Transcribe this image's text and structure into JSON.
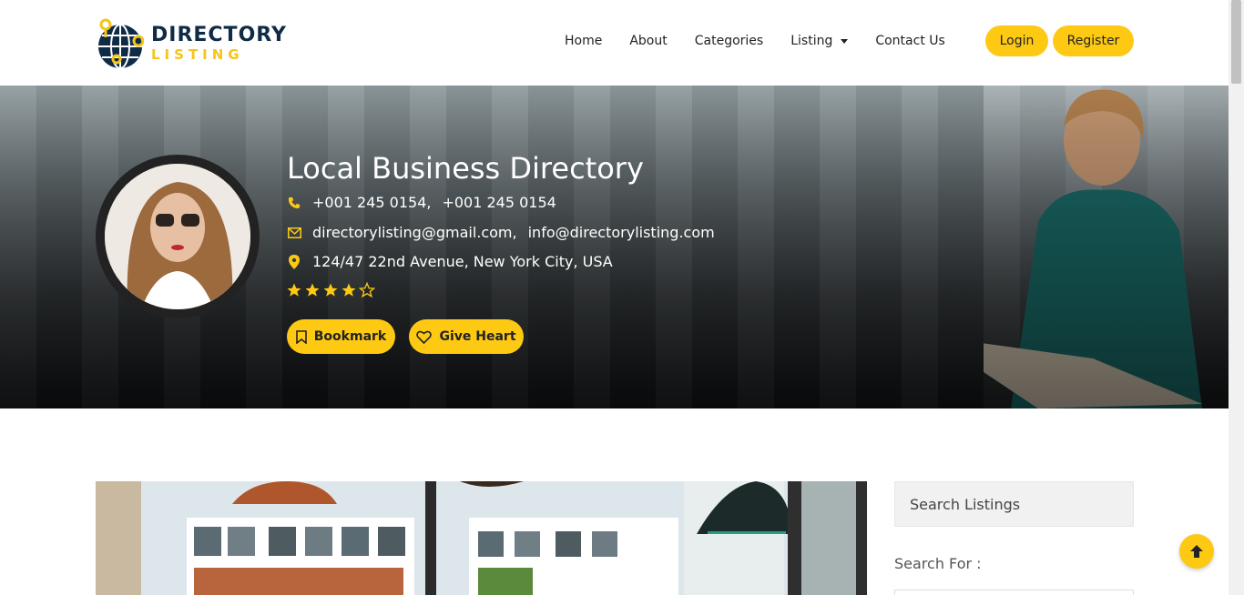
{
  "brand": {
    "title": "DIRECTORY",
    "subtitle": "LISTING"
  },
  "nav": {
    "items": [
      {
        "label": "Home"
      },
      {
        "label": "About"
      },
      {
        "label": "Categories"
      },
      {
        "label": "Listing",
        "has_dropdown": true
      },
      {
        "label": "Contact Us"
      }
    ],
    "login_label": "Login",
    "register_label": "Register"
  },
  "hero": {
    "title": "Local Business Directory",
    "phone_1": "+001 245 0154,",
    "phone_2": "+001 245 0154",
    "email_1": "directorylisting@gmail.com,",
    "email_2": "info@directorylisting.com",
    "address": "124/47 22nd Avenue, New York City, USA",
    "rating": 4,
    "rating_max": 5,
    "bookmark_label": "Bookmark",
    "heart_label": "Give Heart"
  },
  "sidebar": {
    "search_placeholder": "Search Listings",
    "search_for_label": "Search For :"
  },
  "icons": {
    "phone": "phone-icon",
    "email": "envelope-icon",
    "address": "map-marker-icon",
    "bookmark": "bookmark-icon",
    "heart": "heart-icon",
    "back_to_top": "arrow-up-icon"
  },
  "colors": {
    "accent": "#fdc913",
    "brand_dark": "#0f2b46",
    "text_dark": "#222222"
  }
}
